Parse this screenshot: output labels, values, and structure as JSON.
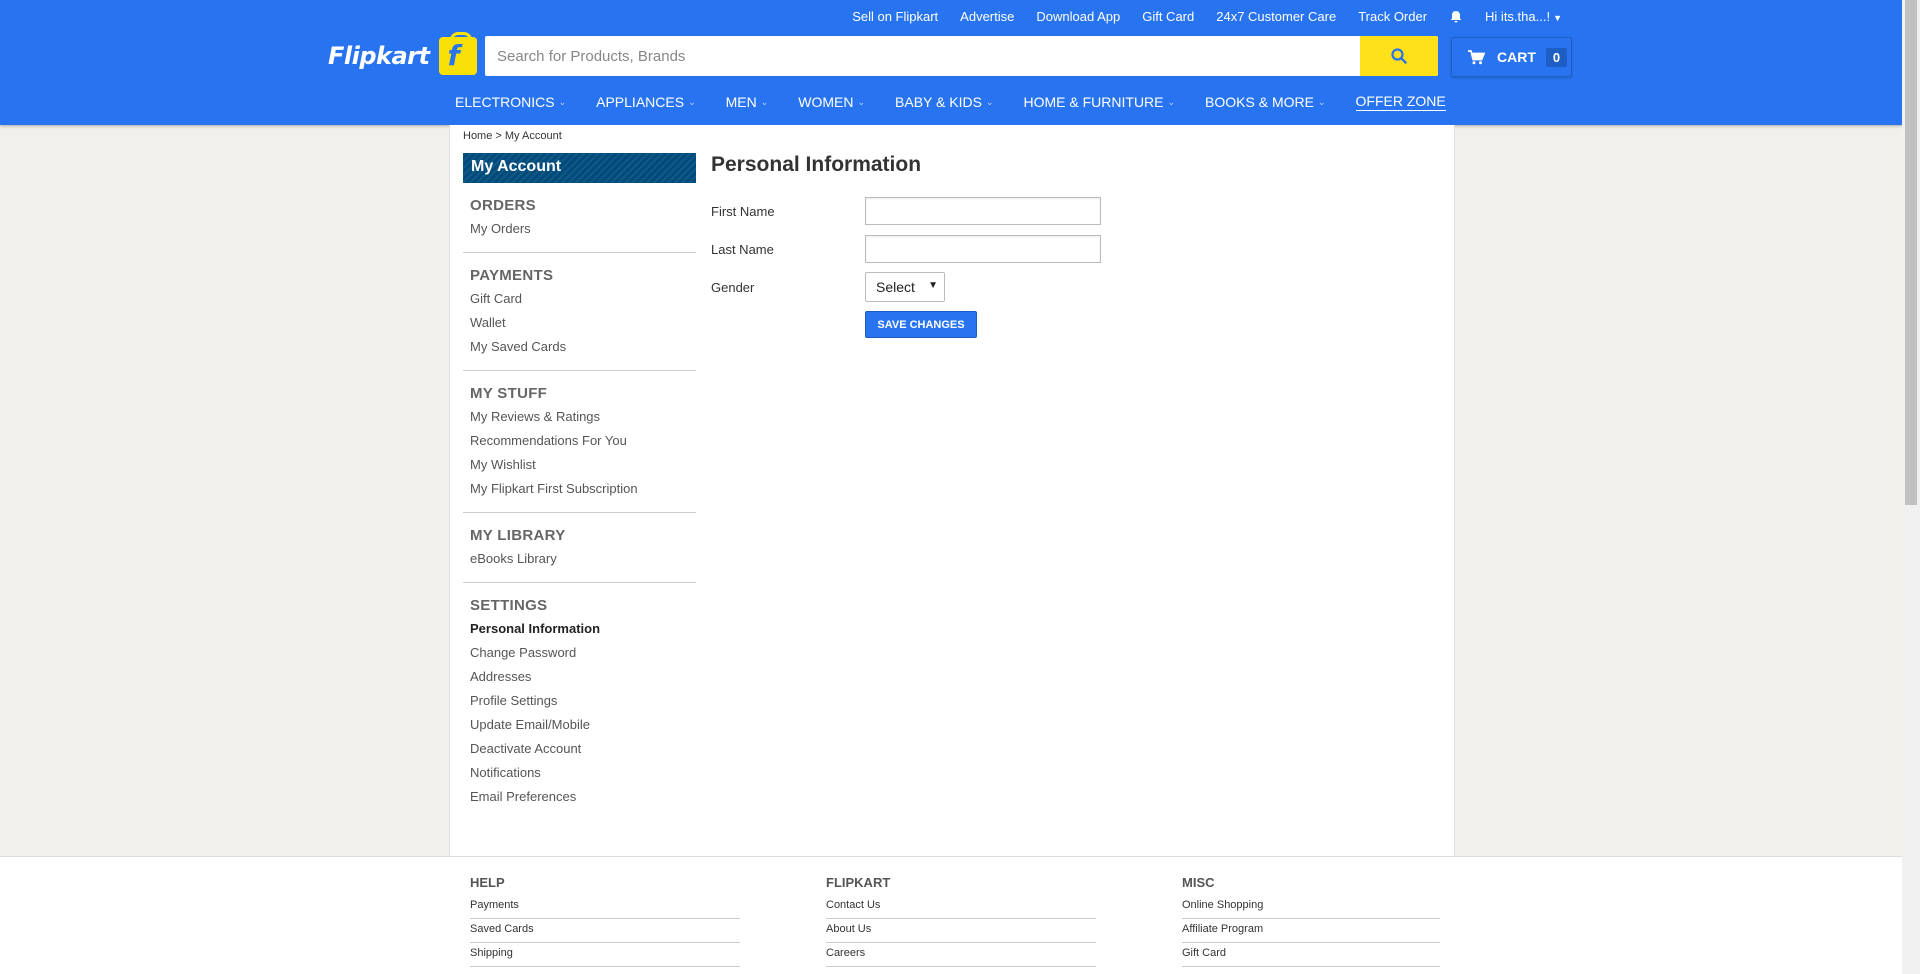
{
  "toplinks": {
    "sell": "Sell on Flipkart",
    "advertise": "Advertise",
    "download": "Download App",
    "giftcard": "Gift Card",
    "care": "24x7 Customer Care",
    "track": "Track Order",
    "user": "Hi its.tha...!"
  },
  "logo": {
    "text": "Flipkart"
  },
  "search": {
    "placeholder": "Search for Products, Brands"
  },
  "cart": {
    "label": "CART",
    "count": "0"
  },
  "nav": [
    "ELECTRONICS",
    "APPLIANCES",
    "MEN",
    "WOMEN",
    "BABY & KIDS",
    "HOME & FURNITURE",
    "BOOKS & MORE",
    "OFFER ZONE"
  ],
  "breadcrumb": {
    "home": "Home",
    "sep": " > ",
    "current": "My Account"
  },
  "sidebar": {
    "title": "My Account",
    "sections": [
      {
        "head": "ORDERS",
        "items": [
          "My Orders"
        ]
      },
      {
        "head": "PAYMENTS",
        "items": [
          "Gift Card",
          "Wallet",
          "My Saved Cards"
        ]
      },
      {
        "head": "MY STUFF",
        "items": [
          "My Reviews & Ratings",
          "Recommendations For You",
          "My Wishlist",
          "My Flipkart First Subscription"
        ]
      },
      {
        "head": "MY LIBRARY",
        "items": [
          "eBooks Library"
        ]
      },
      {
        "head": "SETTINGS",
        "items": [
          "Personal Information",
          "Change Password",
          "Addresses",
          "Profile Settings",
          "Update Email/Mobile",
          "Deactivate Account",
          "Notifications",
          "Email Preferences"
        ]
      }
    ]
  },
  "form": {
    "title": "Personal Information",
    "first_name_label": "First Name",
    "first_name_value": "",
    "last_name_label": "Last Name",
    "last_name_value": "",
    "gender_label": "Gender",
    "gender_selected": "Select",
    "save_label": "SAVE CHANGES"
  },
  "footer": {
    "help": {
      "head": "HELP",
      "links": [
        "Payments",
        "Saved Cards",
        "Shipping"
      ]
    },
    "flipkart": {
      "head": "FLIPKART",
      "links": [
        "Contact Us",
        "About Us",
        "Careers"
      ]
    },
    "misc": {
      "head": "MISC",
      "links": [
        "Online Shopping",
        "Affiliate Program",
        "Gift Card"
      ]
    }
  },
  "colors": {
    "brand": "#2874f0",
    "accent": "#ffe11b",
    "sidebar_header": "#004b7c"
  }
}
